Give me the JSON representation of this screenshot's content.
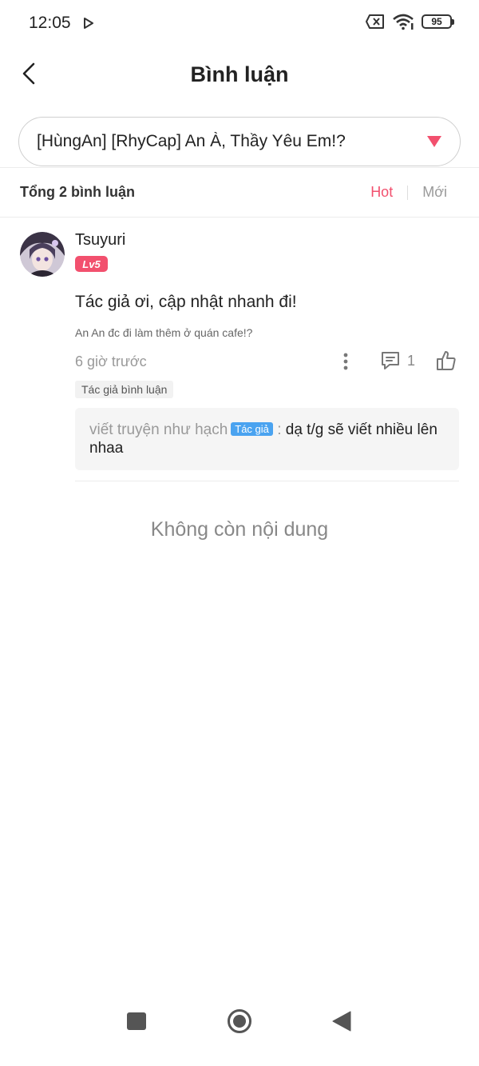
{
  "status_bar": {
    "time": "12:05",
    "battery": "95",
    "icons": [
      "play-icon",
      "sim-x-icon",
      "wifi-icon",
      "battery-icon"
    ]
  },
  "header": {
    "title": "Bình luận",
    "back_icon": "chevron-left-icon"
  },
  "chapter_selector": {
    "value": "[HùngAn] [RhyCap] An À, Thầy Yêu Em!?",
    "icon": "caret-down-icon",
    "accent_color": "#f2506e"
  },
  "sort_bar": {
    "total": "Tổng 2 bình luận",
    "tabs": [
      {
        "label": "Hot",
        "active": true
      },
      {
        "label": "Mới",
        "active": false
      }
    ]
  },
  "comments": [
    {
      "username": "Tsuyuri",
      "level": "Lv5",
      "text": "Tác giả ơi, cập nhật nhanh đi!",
      "chapter": "An An đc đi làm thêm ở quán cafe!?",
      "time": "6 giờ trước",
      "reply_count": "1",
      "tag": "Tác giả bình luận",
      "reply": {
        "name": "viết truyện như hạch",
        "badge": "Tác giả",
        "separator": ":",
        "content": "dạ t/g sẽ viết nhiều lên nhaa"
      }
    }
  ],
  "footer": {
    "no_more": "Không còn nội dung"
  },
  "colors": {
    "accent": "#f2506e",
    "author_badge": "#4aa3f0"
  }
}
